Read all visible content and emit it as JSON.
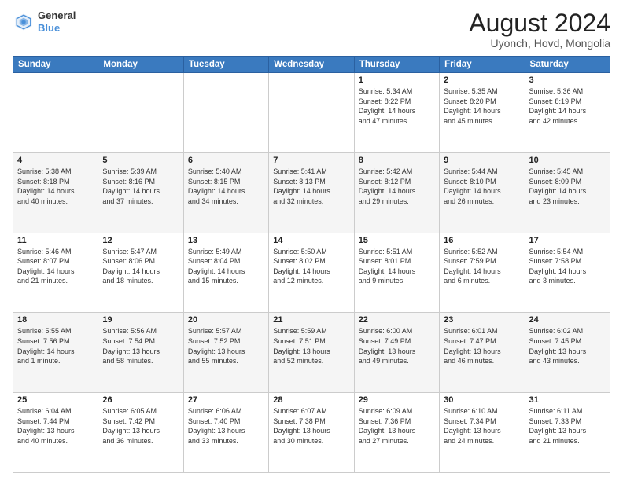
{
  "header": {
    "logo_line1": "General",
    "logo_line2": "Blue",
    "month": "August 2024",
    "location": "Uyonch, Hovd, Mongolia"
  },
  "weekdays": [
    "Sunday",
    "Monday",
    "Tuesday",
    "Wednesday",
    "Thursday",
    "Friday",
    "Saturday"
  ],
  "weeks": [
    [
      {
        "day": "",
        "info": ""
      },
      {
        "day": "",
        "info": ""
      },
      {
        "day": "",
        "info": ""
      },
      {
        "day": "",
        "info": ""
      },
      {
        "day": "1",
        "info": "Sunrise: 5:34 AM\nSunset: 8:22 PM\nDaylight: 14 hours\nand 47 minutes."
      },
      {
        "day": "2",
        "info": "Sunrise: 5:35 AM\nSunset: 8:20 PM\nDaylight: 14 hours\nand 45 minutes."
      },
      {
        "day": "3",
        "info": "Sunrise: 5:36 AM\nSunset: 8:19 PM\nDaylight: 14 hours\nand 42 minutes."
      }
    ],
    [
      {
        "day": "4",
        "info": "Sunrise: 5:38 AM\nSunset: 8:18 PM\nDaylight: 14 hours\nand 40 minutes."
      },
      {
        "day": "5",
        "info": "Sunrise: 5:39 AM\nSunset: 8:16 PM\nDaylight: 14 hours\nand 37 minutes."
      },
      {
        "day": "6",
        "info": "Sunrise: 5:40 AM\nSunset: 8:15 PM\nDaylight: 14 hours\nand 34 minutes."
      },
      {
        "day": "7",
        "info": "Sunrise: 5:41 AM\nSunset: 8:13 PM\nDaylight: 14 hours\nand 32 minutes."
      },
      {
        "day": "8",
        "info": "Sunrise: 5:42 AM\nSunset: 8:12 PM\nDaylight: 14 hours\nand 29 minutes."
      },
      {
        "day": "9",
        "info": "Sunrise: 5:44 AM\nSunset: 8:10 PM\nDaylight: 14 hours\nand 26 minutes."
      },
      {
        "day": "10",
        "info": "Sunrise: 5:45 AM\nSunset: 8:09 PM\nDaylight: 14 hours\nand 23 minutes."
      }
    ],
    [
      {
        "day": "11",
        "info": "Sunrise: 5:46 AM\nSunset: 8:07 PM\nDaylight: 14 hours\nand 21 minutes."
      },
      {
        "day": "12",
        "info": "Sunrise: 5:47 AM\nSunset: 8:06 PM\nDaylight: 14 hours\nand 18 minutes."
      },
      {
        "day": "13",
        "info": "Sunrise: 5:49 AM\nSunset: 8:04 PM\nDaylight: 14 hours\nand 15 minutes."
      },
      {
        "day": "14",
        "info": "Sunrise: 5:50 AM\nSunset: 8:02 PM\nDaylight: 14 hours\nand 12 minutes."
      },
      {
        "day": "15",
        "info": "Sunrise: 5:51 AM\nSunset: 8:01 PM\nDaylight: 14 hours\nand 9 minutes."
      },
      {
        "day": "16",
        "info": "Sunrise: 5:52 AM\nSunset: 7:59 PM\nDaylight: 14 hours\nand 6 minutes."
      },
      {
        "day": "17",
        "info": "Sunrise: 5:54 AM\nSunset: 7:58 PM\nDaylight: 14 hours\nand 3 minutes."
      }
    ],
    [
      {
        "day": "18",
        "info": "Sunrise: 5:55 AM\nSunset: 7:56 PM\nDaylight: 14 hours\nand 1 minute."
      },
      {
        "day": "19",
        "info": "Sunrise: 5:56 AM\nSunset: 7:54 PM\nDaylight: 13 hours\nand 58 minutes."
      },
      {
        "day": "20",
        "info": "Sunrise: 5:57 AM\nSunset: 7:52 PM\nDaylight: 13 hours\nand 55 minutes."
      },
      {
        "day": "21",
        "info": "Sunrise: 5:59 AM\nSunset: 7:51 PM\nDaylight: 13 hours\nand 52 minutes."
      },
      {
        "day": "22",
        "info": "Sunrise: 6:00 AM\nSunset: 7:49 PM\nDaylight: 13 hours\nand 49 minutes."
      },
      {
        "day": "23",
        "info": "Sunrise: 6:01 AM\nSunset: 7:47 PM\nDaylight: 13 hours\nand 46 minutes."
      },
      {
        "day": "24",
        "info": "Sunrise: 6:02 AM\nSunset: 7:45 PM\nDaylight: 13 hours\nand 43 minutes."
      }
    ],
    [
      {
        "day": "25",
        "info": "Sunrise: 6:04 AM\nSunset: 7:44 PM\nDaylight: 13 hours\nand 40 minutes."
      },
      {
        "day": "26",
        "info": "Sunrise: 6:05 AM\nSunset: 7:42 PM\nDaylight: 13 hours\nand 36 minutes."
      },
      {
        "day": "27",
        "info": "Sunrise: 6:06 AM\nSunset: 7:40 PM\nDaylight: 13 hours\nand 33 minutes."
      },
      {
        "day": "28",
        "info": "Sunrise: 6:07 AM\nSunset: 7:38 PM\nDaylight: 13 hours\nand 30 minutes."
      },
      {
        "day": "29",
        "info": "Sunrise: 6:09 AM\nSunset: 7:36 PM\nDaylight: 13 hours\nand 27 minutes."
      },
      {
        "day": "30",
        "info": "Sunrise: 6:10 AM\nSunset: 7:34 PM\nDaylight: 13 hours\nand 24 minutes."
      },
      {
        "day": "31",
        "info": "Sunrise: 6:11 AM\nSunset: 7:33 PM\nDaylight: 13 hours\nand 21 minutes."
      }
    ]
  ]
}
